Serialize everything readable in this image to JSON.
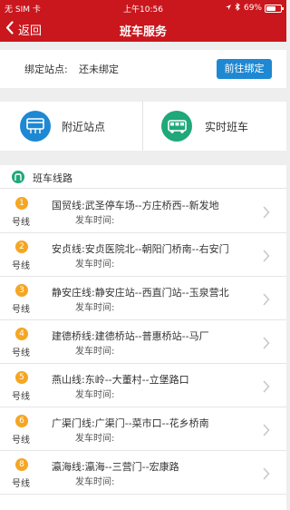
{
  "status_bar": {
    "carrier": "无 SIM 卡",
    "time": "上午10:56",
    "battery": "69%",
    "battery_level": 0.69
  },
  "header": {
    "back_label": "返回",
    "title": "班车服务"
  },
  "binding": {
    "label": "绑定站点:",
    "value": "还未绑定",
    "button_label": "前往绑定"
  },
  "quick_actions": [
    {
      "label": "附近站点",
      "icon": "bus-stop-sign-icon"
    },
    {
      "label": "实时班车",
      "icon": "bus-icon"
    }
  ],
  "routes_section": {
    "title": "班车线路",
    "icon": "route-icon"
  },
  "routes": [
    {
      "number": "1",
      "suffix": "号线",
      "name": "国贸线:武圣停车场--方庄桥西--新发地",
      "time_label": "发车时间:"
    },
    {
      "number": "2",
      "suffix": "号线",
      "name": "安贞线:安贞医院北--朝阳门桥南--右安门",
      "time_label": "发车时间:"
    },
    {
      "number": "3",
      "suffix": "号线",
      "name": "静安庄线:静安庄站--西直门站--玉泉营北",
      "time_label": "发车时间:"
    },
    {
      "number": "4",
      "suffix": "号线",
      "name": "建德桥线:建德桥站--普惠桥站--马厂",
      "time_label": "发车时间:"
    },
    {
      "number": "5",
      "suffix": "号线",
      "name": "燕山线:东岭--大董村--立堡路口",
      "time_label": "发车时间:"
    },
    {
      "number": "6",
      "suffix": "号线",
      "name": "广渠门线:广渠门--菜市口--花乡桥南",
      "time_label": "发车时间:"
    },
    {
      "number": "8",
      "suffix": "号线",
      "name": "瀛海线:瀛海--三营门--宏康路",
      "time_label": "发车时间:"
    }
  ],
  "colors": {
    "header_red": "#c9171d",
    "button_blue": "#1e88d2",
    "accent_green": "#1fa87a",
    "badge_orange": "#f5a623"
  }
}
